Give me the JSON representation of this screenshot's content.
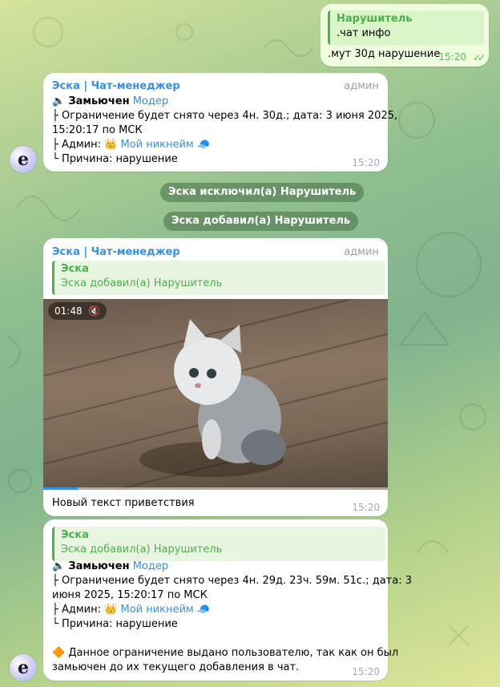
{
  "outgoing": {
    "quote_name": "Нарушитель",
    "quote_text": ".чат инфо",
    "text": ".мут 30д нарушение",
    "time": "15:20"
  },
  "msg1": {
    "sender": "Эска | Чат-менеджер",
    "role": "админ",
    "muted_label": "Замьючен",
    "muted_user": "Модер",
    "line_restriction_1": "├ Ограничение будет снято через 4н. 30д.; дата: 3 июня 2025,",
    "line_restriction_2": "15:20:17 по МСК",
    "admin_prefix": "├ Админ: ",
    "admin_crown": "👑",
    "admin_name": "Мой никнейм",
    "admin_cap": "🧢",
    "reason": "└ Причина: нарушение",
    "time": "15:20"
  },
  "service1": "Эска исключил(а) Нарушитель",
  "service2": "Эска добавил(а) Нарушитель",
  "msg2": {
    "sender": "Эска | Чат-менеджер",
    "role": "админ",
    "quote_name": "Эска",
    "quote_text": "Эска добавил(а) Нарушитель",
    "video_duration": "01:48",
    "video_progress": 0.1,
    "caption": "Новый текст приветствия",
    "time": "15:20"
  },
  "msg3": {
    "quote_name": "Эска",
    "quote_text": "Эска добавил(а) Нарушитель",
    "muted_label": "Замьючен",
    "muted_user": "Модер",
    "line_restriction_1": "├ Ограничение будет снято через 4н. 29д. 23ч. 59м. 51с.; дата: 3",
    "line_restriction_2": "июня 2025, 15:20:17 по МСК",
    "admin_prefix": "├ Админ: ",
    "admin_crown": "👑",
    "admin_name": "Мой никнейм",
    "admin_cap": "🧢",
    "reason": "└ Причина: нарушение",
    "note_icon": "🔶",
    "note_1": " Данное ограничение выдано пользователю, так как он был",
    "note_2": "замьючен до их текущего добавления в чат.",
    "time": "15:20"
  },
  "avatar_letter": "e",
  "colors": {
    "accent": "#3390ec",
    "quote": "#4fae4e",
    "outgoing_bg": "#effdde"
  }
}
